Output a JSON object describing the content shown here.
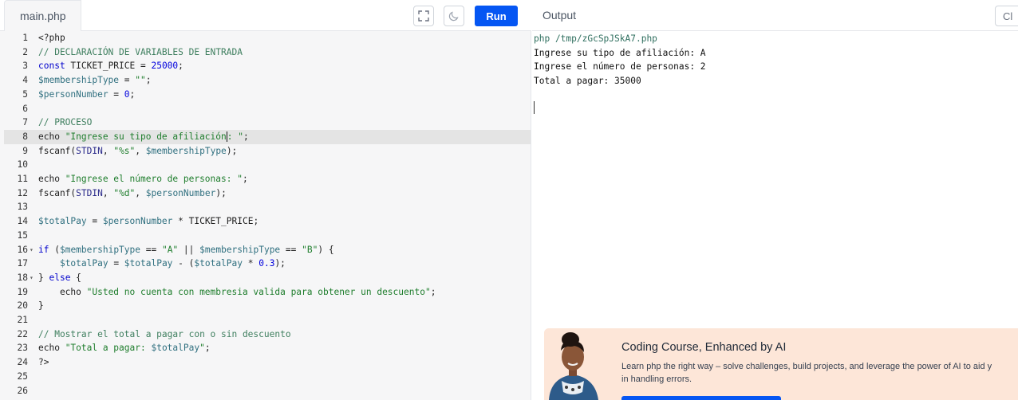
{
  "editor": {
    "tab_label": "main.php",
    "run_label": "Run",
    "active_line": 8,
    "lines": [
      {
        "n": "1",
        "fold": "",
        "tokens": [
          [
            "def",
            "<?php"
          ]
        ]
      },
      {
        "n": "2",
        "fold": "",
        "tokens": [
          [
            "com",
            "// DECLARACIÓN DE VARIABLES DE ENTRADA"
          ]
        ]
      },
      {
        "n": "3",
        "fold": "",
        "tokens": [
          [
            "kw",
            "const"
          ],
          [
            "def",
            " TICKET_PRICE = "
          ],
          [
            "num",
            "25000"
          ],
          [
            "def",
            ";"
          ]
        ]
      },
      {
        "n": "4",
        "fold": "",
        "tokens": [
          [
            "var",
            "$membershipType"
          ],
          [
            "def",
            " = "
          ],
          [
            "str",
            "\"\""
          ],
          [
            "def",
            ";"
          ]
        ]
      },
      {
        "n": "5",
        "fold": "",
        "tokens": [
          [
            "var",
            "$personNumber"
          ],
          [
            "def",
            " = "
          ],
          [
            "num",
            "0"
          ],
          [
            "def",
            ";"
          ]
        ]
      },
      {
        "n": "6",
        "fold": "",
        "tokens": []
      },
      {
        "n": "7",
        "fold": "",
        "tokens": [
          [
            "com",
            "// PROCESO"
          ]
        ]
      },
      {
        "n": "8",
        "fold": "",
        "tokens": [
          [
            "def",
            "echo "
          ],
          [
            "str",
            "\"Ingrese su tipo de afiliación"
          ],
          [
            "cursor",
            ""
          ],
          [
            "str",
            ": \""
          ],
          [
            "def",
            ";"
          ]
        ]
      },
      {
        "n": "9",
        "fold": "",
        "tokens": [
          [
            "def",
            "fscanf("
          ],
          [
            "const",
            "STDIN"
          ],
          [
            "def",
            ", "
          ],
          [
            "str",
            "\"%s\""
          ],
          [
            "def",
            ", "
          ],
          [
            "var",
            "$membershipType"
          ],
          [
            "def",
            ");"
          ]
        ]
      },
      {
        "n": "10",
        "fold": "",
        "tokens": []
      },
      {
        "n": "11",
        "fold": "",
        "tokens": [
          [
            "def",
            "echo "
          ],
          [
            "str",
            "\"Ingrese el número de personas: \""
          ],
          [
            "def",
            ";"
          ]
        ]
      },
      {
        "n": "12",
        "fold": "",
        "tokens": [
          [
            "def",
            "fscanf("
          ],
          [
            "const",
            "STDIN"
          ],
          [
            "def",
            ", "
          ],
          [
            "str",
            "\"%d\""
          ],
          [
            "def",
            ", "
          ],
          [
            "var",
            "$personNumber"
          ],
          [
            "def",
            ");"
          ]
        ]
      },
      {
        "n": "13",
        "fold": "",
        "tokens": []
      },
      {
        "n": "14",
        "fold": "",
        "tokens": [
          [
            "var",
            "$totalPay"
          ],
          [
            "def",
            " = "
          ],
          [
            "var",
            "$personNumber"
          ],
          [
            "def",
            " * TICKET_PRICE;"
          ]
        ]
      },
      {
        "n": "15",
        "fold": "",
        "tokens": []
      },
      {
        "n": "16",
        "fold": "▾",
        "tokens": [
          [
            "kw",
            "if"
          ],
          [
            "def",
            " ("
          ],
          [
            "var",
            "$membershipType"
          ],
          [
            "def",
            " == "
          ],
          [
            "str",
            "\"A\""
          ],
          [
            "def",
            " || "
          ],
          [
            "var",
            "$membershipType"
          ],
          [
            "def",
            " == "
          ],
          [
            "str",
            "\"B\""
          ],
          [
            "def",
            ") {"
          ]
        ]
      },
      {
        "n": "17",
        "fold": "",
        "tokens": [
          [
            "def",
            "    "
          ],
          [
            "var",
            "$totalPay"
          ],
          [
            "def",
            " = "
          ],
          [
            "var",
            "$totalPay"
          ],
          [
            "def",
            " - ("
          ],
          [
            "var",
            "$totalPay"
          ],
          [
            "def",
            " * "
          ],
          [
            "num",
            "0.3"
          ],
          [
            "def",
            ");"
          ]
        ]
      },
      {
        "n": "18",
        "fold": "▾",
        "tokens": [
          [
            "def",
            "} "
          ],
          [
            "kw",
            "else"
          ],
          [
            "def",
            " {"
          ]
        ]
      },
      {
        "n": "19",
        "fold": "",
        "tokens": [
          [
            "def",
            "    echo "
          ],
          [
            "str",
            "\"Usted no cuenta con membresia valida para obtener un descuento\""
          ],
          [
            "def",
            ";"
          ]
        ]
      },
      {
        "n": "20",
        "fold": "",
        "tokens": [
          [
            "def",
            "}"
          ]
        ]
      },
      {
        "n": "21",
        "fold": "",
        "tokens": []
      },
      {
        "n": "22",
        "fold": "",
        "tokens": [
          [
            "com",
            "// Mostrar el total a pagar con o sin descuento"
          ]
        ]
      },
      {
        "n": "23",
        "fold": "",
        "tokens": [
          [
            "def",
            "echo "
          ],
          [
            "str",
            "\"Total a pagar: "
          ],
          [
            "var",
            "$totalPay"
          ],
          [
            "str",
            "\""
          ],
          [
            "def",
            ";"
          ]
        ]
      },
      {
        "n": "24",
        "fold": "",
        "tokens": [
          [
            "def",
            "?>"
          ]
        ]
      },
      {
        "n": "25",
        "fold": "",
        "tokens": []
      },
      {
        "n": "26",
        "fold": "",
        "tokens": []
      }
    ]
  },
  "output": {
    "title": "Output",
    "clear_label": "Cl",
    "lines": [
      "php /tmp/zGcSpJSkA7.php",
      "Ingrese su tipo de afiliación: A",
      "Ingrese el número de personas: 2",
      "Total a pagar: 35000"
    ]
  },
  "ad": {
    "title": "Coding Course, Enhanced by AI",
    "description_line1": "Learn php the right way – solve challenges, build projects, and leverage the power of AI to aid y",
    "description_line2": "in handling errors."
  },
  "colors": {
    "accent": "#0556f3",
    "ad_background": "#fde6d8",
    "active_line": "#e4e4e4"
  }
}
